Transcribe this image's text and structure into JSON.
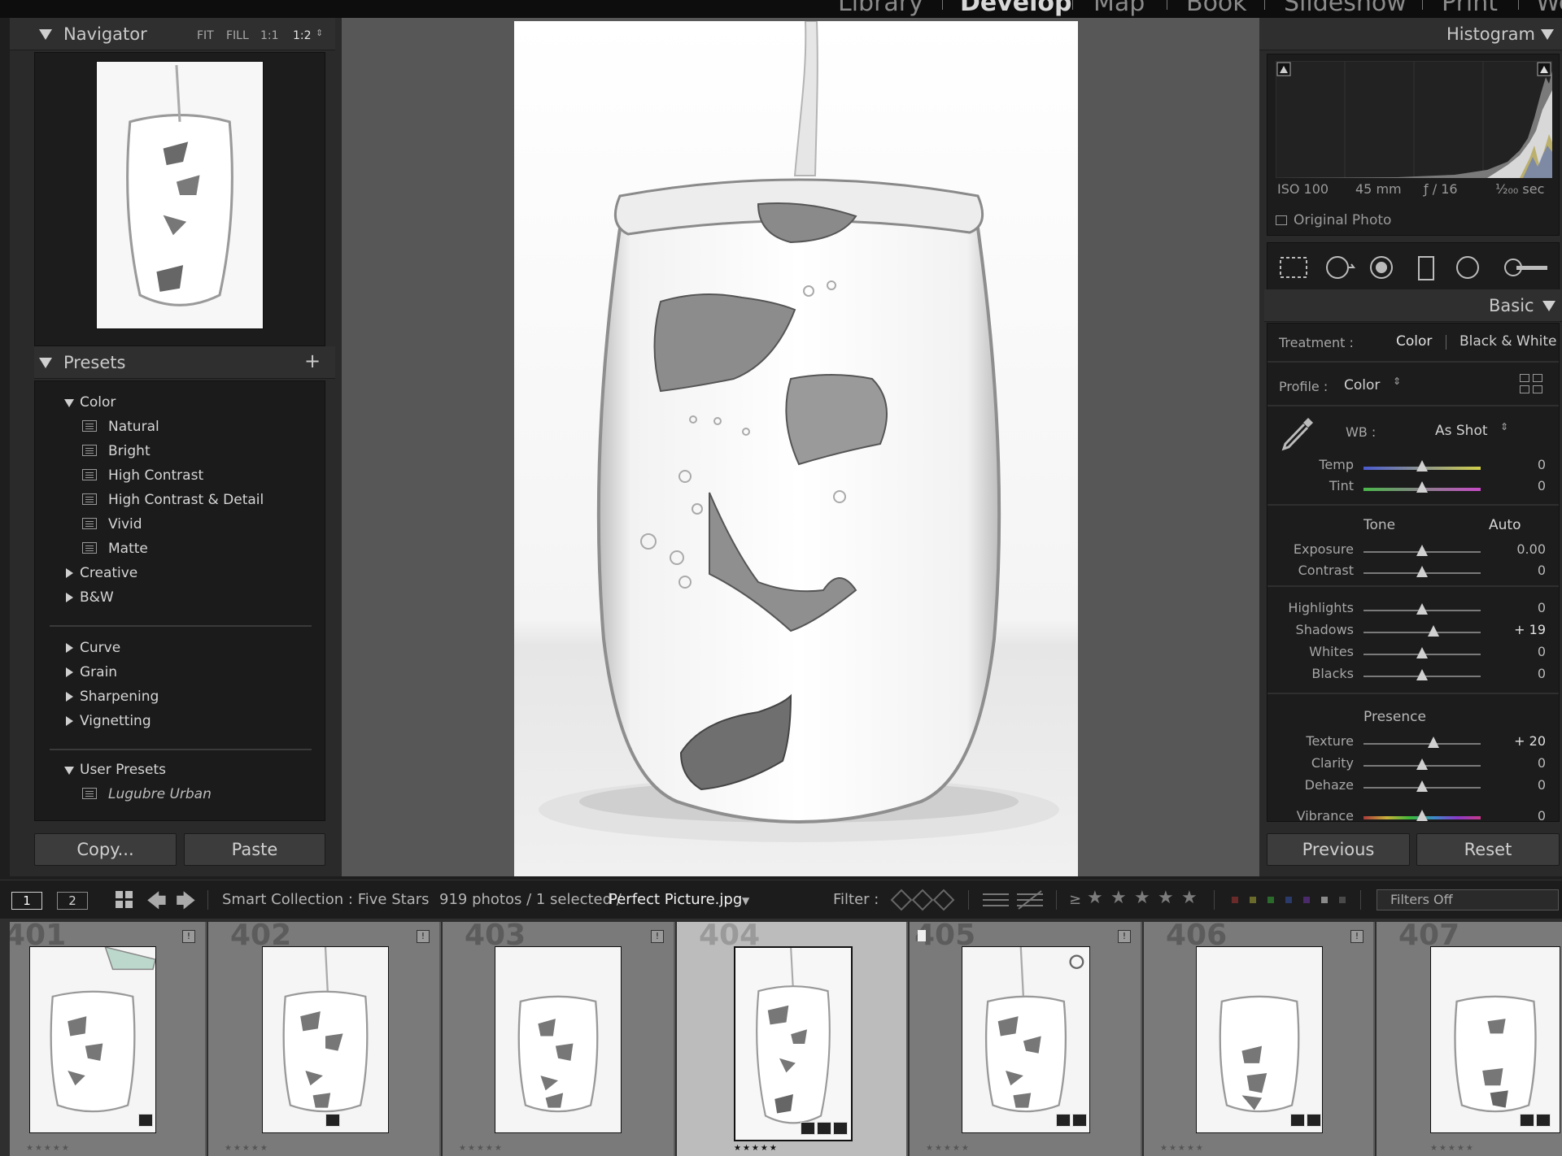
{
  "top_modules": {
    "items": [
      "Library",
      "Develop",
      "Map",
      "Book",
      "Slideshow",
      "Print",
      "Web"
    ],
    "active": "Develop"
  },
  "navigator": {
    "title": "Navigator",
    "zoom": [
      "FIT",
      "FILL",
      "1:1",
      "1:2"
    ]
  },
  "presets": {
    "title": "Presets",
    "add": "+",
    "groups": [
      {
        "label": "Color",
        "open": true,
        "items": [
          "Natural",
          "Bright",
          "High Contrast",
          "High Contrast & Detail",
          "Vivid",
          "Matte"
        ]
      },
      {
        "label": "Creative",
        "open": false
      },
      {
        "label": "B&W",
        "open": false
      },
      {
        "label": "Curve",
        "open": false
      },
      {
        "label": "Grain",
        "open": false
      },
      {
        "label": "Sharpening",
        "open": false
      },
      {
        "label": "Vignetting",
        "open": false
      },
      {
        "label": "User Presets",
        "open": true,
        "items": [
          "Lugubre Urban"
        ]
      }
    ]
  },
  "left_buttons": {
    "copy": "Copy...",
    "paste": "Paste"
  },
  "histogram": {
    "title": "Histogram",
    "iso": "ISO 100",
    "focal": "45 mm",
    "aperture": "ƒ / 16",
    "shutter": "¹⁄₂₀₀ sec",
    "original_photo": "Original Photo"
  },
  "basic": {
    "title": "Basic",
    "treatment_label": "Treatment :",
    "treatment_color": "Color",
    "treatment_bw": "Black & White",
    "profile_label": "Profile :",
    "profile_value": "Color",
    "wb_label": "WB :",
    "wb_value": "As Shot",
    "tone_label": "Tone",
    "auto_label": "Auto",
    "presence_label": "Presence",
    "sliders": {
      "temp": {
        "label": "Temp",
        "value": "0",
        "pos": 0.5
      },
      "tint": {
        "label": "Tint",
        "value": "0",
        "pos": 0.5
      },
      "exposure": {
        "label": "Exposure",
        "value": "0.00",
        "pos": 0.5
      },
      "contrast": {
        "label": "Contrast",
        "value": "0",
        "pos": 0.5
      },
      "highlights": {
        "label": "Highlights",
        "value": "0",
        "pos": 0.5
      },
      "shadows": {
        "label": "Shadows",
        "value": "+ 19",
        "pos": 0.595
      },
      "whites": {
        "label": "Whites",
        "value": "0",
        "pos": 0.5
      },
      "blacks": {
        "label": "Blacks",
        "value": "0",
        "pos": 0.5
      },
      "texture": {
        "label": "Texture",
        "value": "+ 20",
        "pos": 0.6
      },
      "clarity": {
        "label": "Clarity",
        "value": "0",
        "pos": 0.5
      },
      "dehaze": {
        "label": "Dehaze",
        "value": "0",
        "pos": 0.5
      },
      "vibrance": {
        "label": "Vibrance",
        "value": "0",
        "pos": 0.5
      }
    }
  },
  "right_buttons": {
    "previous": "Previous",
    "reset": "Reset"
  },
  "filmstrip_toolbar": {
    "screen1": "1",
    "screen2": "2",
    "source": "Smart Collection : Five Stars",
    "count": "919 photos / 1 selected /",
    "filename": "Perfect Picture.jpg",
    "filter_label": "Filter :",
    "rating_op": "≥",
    "filters_off": "Filters Off"
  },
  "filmstrip": {
    "cells": [
      {
        "num": "401",
        "stars": "★★★★★",
        "selected": false
      },
      {
        "num": "402",
        "stars": "★★★★★",
        "selected": false
      },
      {
        "num": "403",
        "stars": "★★★★★",
        "selected": false
      },
      {
        "num": "404",
        "stars": "★★★★★",
        "selected": true
      },
      {
        "num": "405",
        "stars": "★★★★★",
        "selected": false
      },
      {
        "num": "406",
        "stars": "★★★★★",
        "selected": false
      },
      {
        "num": "407",
        "stars": "★★★★★",
        "selected": false
      }
    ]
  },
  "colors": {
    "panel_bg": "#2a2a2a",
    "panel_inner": "#1c1c1c",
    "center_bg": "#575757",
    "filmstrip_cell": "#7a7a7a",
    "selected_cell": "#bcbcbc"
  }
}
